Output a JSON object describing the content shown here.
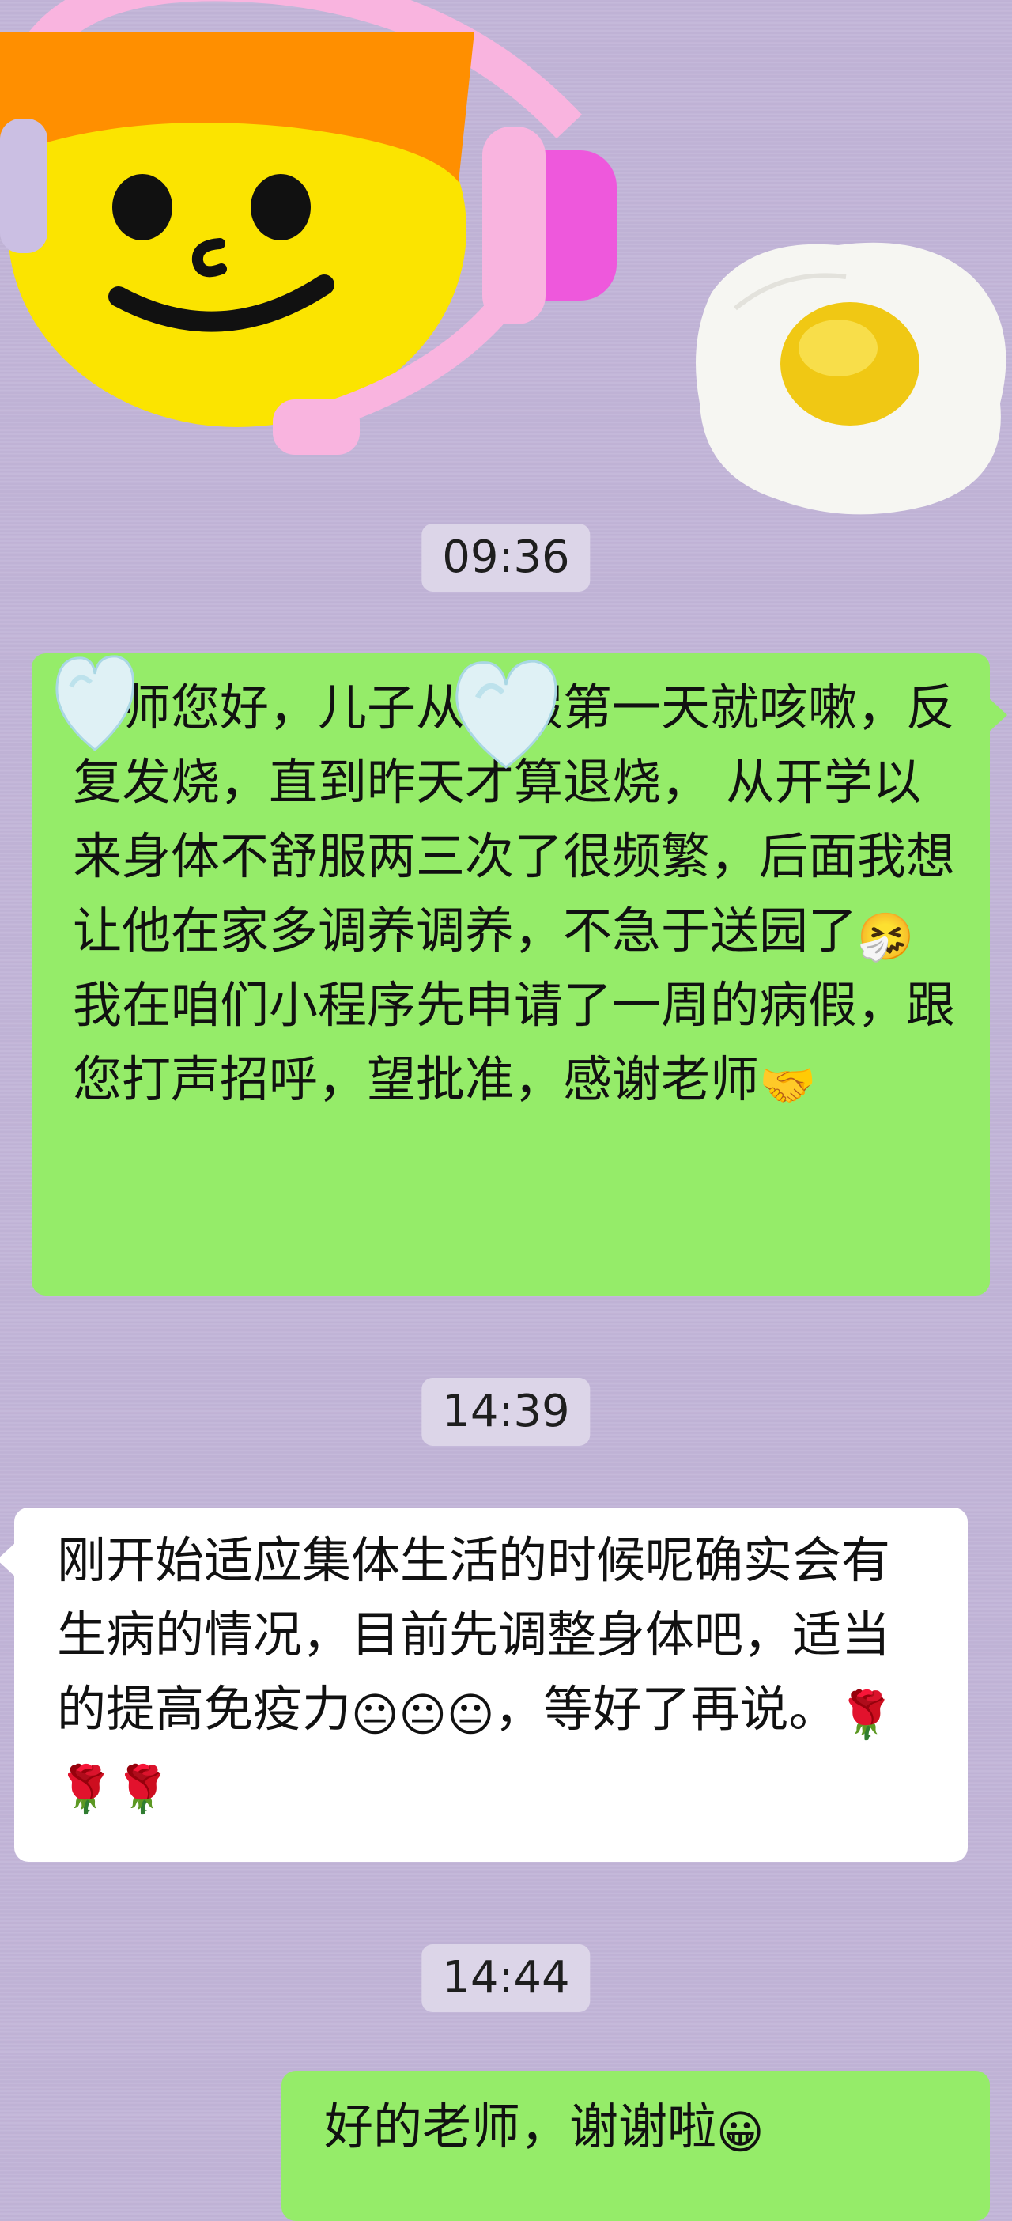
{
  "timestamps": [
    "09:36",
    "14:39",
    "14:44"
  ],
  "messages": [
    {
      "side": "right",
      "text": "老师您好，儿子从放假第一天就咳嗽，反复发烧，直到昨天才算退烧， 从开学以来身体不舒服两三次了很频繁，后面我想让他在家多调养调养，不急于送园了",
      "text2": " 我在咱们小程序先申请了一周的病假，跟您打声招呼，望批准，感谢老师",
      "emoji_mid": "🤧",
      "emoji_end": "🤝"
    },
    {
      "side": "left",
      "text": "刚开始适应集体生活的时候呢确实会有生病的情况，目前先调整身体吧，适当的提高免疫力",
      "emoji_a": "😐",
      "text2": "，等好了再说。",
      "emoji_b": "🌹"
    },
    {
      "side": "right",
      "text": "好的老师，谢谢啦",
      "emoji_end": "😀"
    }
  ],
  "colors": {
    "background": "#c3b6d9",
    "my_bubble": "#95ec69",
    "their_bubble": "#ffffff",
    "timestamp_bg": "#dcd5e8"
  },
  "stickers": [
    "smiley-headset-sticker",
    "fried-egg-sticker",
    "heart-sticker"
  ]
}
